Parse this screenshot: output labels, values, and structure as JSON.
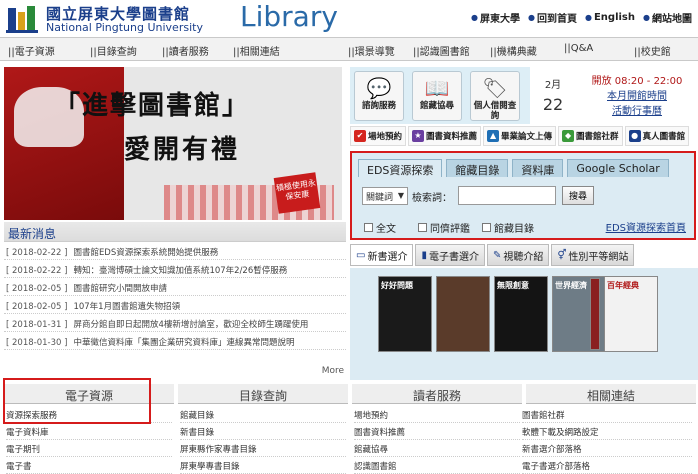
{
  "header": {
    "logo_cn": "國立屏東大學圖書館",
    "logo_en": "National Pingtung University",
    "logo_library": "Library",
    "top_links": [
      "屏東大學",
      "回到首頁",
      "English",
      "網站地圖"
    ]
  },
  "nav": {
    "items": [
      "||電子資源",
      "||目錄查詢",
      "||讀者服務",
      "||相關連結",
      "||環景導覽",
      "||認識圖書館",
      "||機構典藏",
      "||Q&A",
      "||校史館"
    ]
  },
  "banner": {
    "title_line1": "「進擊圖書館」",
    "title_line2": "愛開有禮",
    "badge": "積極使用永保安康",
    "pages": [
      "1",
      "2",
      "3",
      "4"
    ],
    "active_page": "2"
  },
  "news": {
    "title": "最新消息",
    "items": [
      {
        "date": "[ 2018-02-22 ]",
        "text": "圖書館EDS資源探索系統開始提供服務"
      },
      {
        "date": "[ 2018-02-22 ]",
        "text": "轉知：臺灣博碩士論文知識加值系統107年2/26暫停服務"
      },
      {
        "date": "[ 2018-02-05 ]",
        "text": "圖書館研究小間開放申請"
      },
      {
        "date": "[ 2018-02-05 ]",
        "text": "107年1月圖書館遺失物招領"
      },
      {
        "date": "[ 2018-01-31 ]",
        "text": "屏商分館自即日起開放4樓新增討論室，歡迎全校師生踴躍使用"
      },
      {
        "date": "[ 2018-01-30 ]",
        "text": "中華徵信資料庫「集團企業研究資料庫」連線異常問題說明"
      }
    ],
    "more": "More"
  },
  "quick": {
    "buttons": [
      {
        "label": "諮詢服務",
        "icon": "chat-bubbles-icon"
      },
      {
        "label": "館藏協尋",
        "icon": "books-icon"
      },
      {
        "label": "個人借閱查詢",
        "icon": "tag-icon"
      }
    ]
  },
  "date": {
    "month": "2月",
    "day": "22"
  },
  "hours": {
    "open": "開放 08:20 - 22:00",
    "link1": "本月開館時間",
    "link2": "活動行事曆"
  },
  "services": [
    {
      "label": "場地預約",
      "color": "#d5261f"
    },
    {
      "label": "圖書資料推薦",
      "color": "#6a3fa0"
    },
    {
      "label": "畢業論文上傳",
      "color": "#1f6fb5"
    },
    {
      "label": "圖書館社群",
      "color": "#3a9a3a"
    },
    {
      "label": "真人圖書館",
      "color": "#1b3f8b"
    }
  ],
  "search": {
    "tabs": [
      "EDS資源探索",
      "館藏目錄",
      "資料庫",
      "Google Scholar"
    ],
    "active_tab": "EDS資源探索",
    "field_select": "關鍵詞",
    "keyword_label": "檢索詞：",
    "keyword_value": "",
    "go_label": "搜尋",
    "checkboxes": [
      "全文",
      "同儕評鑑",
      "館藏目錄"
    ],
    "eds_home_link": "EDS資源探索首頁"
  },
  "book_tabs": [
    {
      "label": "新書選介",
      "icon": "book-icon"
    },
    {
      "label": "電子書選介",
      "icon": "ebook-icon"
    },
    {
      "label": "視聽介紹",
      "icon": "pencil-icon"
    },
    {
      "label": "性別平等網站",
      "icon": "gender-icon"
    }
  ],
  "books": [
    {
      "text": "好好問題",
      "color": "#1a1a1a"
    },
    {
      "text": "",
      "color": "#5a3b2a"
    },
    {
      "text": "無限創意",
      "color": "#141414"
    },
    {
      "text": "世界經濟",
      "color": "#6e7c86"
    },
    {
      "text": "",
      "color": "#8a2020"
    },
    {
      "text": "百年經典",
      "color": "#f2f2f2"
    }
  ],
  "footer": {
    "columns": [
      {
        "head": "電子資源",
        "links": [
          "資源探索服務",
          "電子資料庫",
          "電子期刊",
          "電子書"
        ]
      },
      {
        "head": "目錄查詢",
        "links": [
          "館藏目錄",
          "新書目錄",
          "屏東縣作家專書目錄",
          "屏東學專書目錄"
        ]
      },
      {
        "head": "讀者服務",
        "links": [
          "場地預約",
          "圖書資料推薦",
          "館藏協尋",
          "認識圖書館"
        ]
      },
      {
        "head": "相關連結",
        "links": [
          "圖書館社群",
          "軟體下載及網路設定",
          "新書選介部落格",
          "電子書選介部落格"
        ]
      }
    ]
  }
}
